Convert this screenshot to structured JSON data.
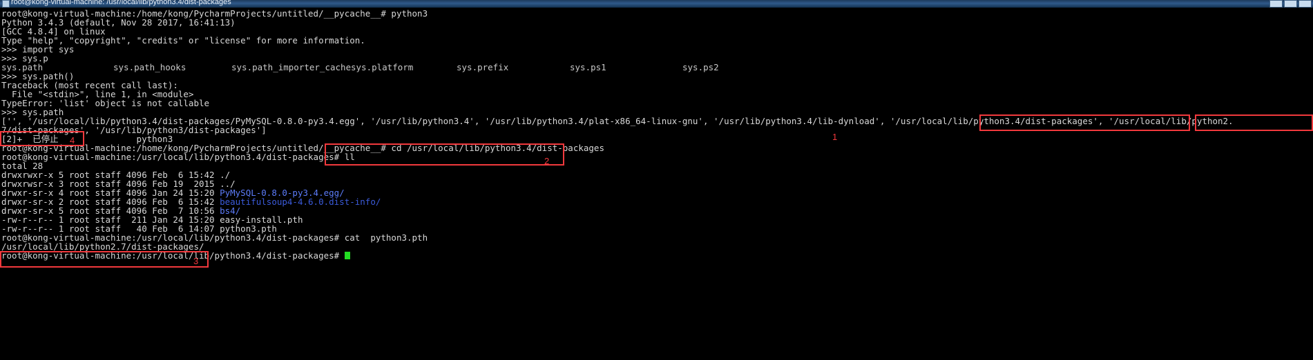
{
  "window": {
    "title": "root@kong-virtual-machine: /usr/local/lib/python3.4/dist-packages",
    "icon": "terminal-icon",
    "buttons": [
      "minimize",
      "maximize",
      "close"
    ]
  },
  "terminal": {
    "lines": [
      "root@kong-virtual-machine:/home/kong/PycharmProjects/untitled/__pycache__# python3",
      "Python 3.4.3 (default, Nov 28 2017, 16:41:13)",
      "[GCC 4.8.4] on linux",
      "Type \"help\", \"copyright\", \"credits\" or \"license\" for more information.",
      ">>> import sys",
      ">>> sys.p",
      ">>> sys.path()",
      "Traceback (most recent call last):",
      "  File \"<stdin>\", line 1, in <module>",
      "TypeError: 'list' object is not callable",
      ">>> sys.path",
      "['', '/usr/local/lib/python3.4/dist-packages/PyMySQL-0.8.0-py3.4.egg', '/usr/lib/python3.4', '/usr/lib/python3.4/plat-x86_64-linux-gnu', '/usr/lib/python3.4/lib-dynload', '/usr/local/lib/python3.4/dist-packages', '/usr/local/lib/python2.",
      "7/dist-packages', '/usr/lib/python3/dist-packages']",
      "[2]+  已停止               python3",
      "root@kong-virtual-machine:/home/kong/PycharmProjects/untitled/__pycache__# cd /usr/local/lib/python3.4/dist-packages",
      "root@kong-virtual-machine:/usr/local/lib/python3.4/dist-packages# ll",
      "total 28",
      "drwxrwxr-x 5 root staff 4096 Feb  6 15:42 ./",
      "drwxrwsr-x 3 root staff 4096 Feb 19  2015 ../",
      "drwxr-sr-x 4 root staff 4096 Jan 24 15:20 PyMySQL-0.8.0-py3.4.egg/",
      "drwxr-sr-x 2 root staff 4096 Feb  6 15:42 beautifulsoup4-4.6.0.dist-info/",
      "drwxr-sr-x 5 root staff 4096 Feb  7 10:56 bs4/",
      "-rw-r--r-- 1 root staff  211 Jan 24 15:20 easy-install.pth",
      "-rw-r--r-- 1 root staff   40 Feb  6 14:07 python3.pth",
      "root@kong-virtual-machine:/usr/local/lib/python3.4/dist-packages# cat  python3.pth",
      "/usr/local/lib/python2.7/dist-packages/",
      "root@kong-virtual-machine:/usr/local/lib/python3.4/dist-packages# "
    ],
    "completions": [
      "sys.path",
      "sys.path_hooks",
      "sys.path_importer_cache",
      "sys.platform",
      "sys.prefix",
      "sys.ps1",
      "sys.ps2"
    ],
    "listing_dir_color": "#5c7cfa",
    "prompt_user": "root@kong-virtual-machine",
    "cursor": "block-cursor"
  },
  "annotations": [
    {
      "number": "1",
      "target": "'/usr/local/lib/python3.4/dist-packages'"
    },
    {
      "number": "2",
      "target": "cd /usr/local/lib/python3.4/dist-packages"
    },
    {
      "number": "3",
      "target": "/usr/local/lib/python2.7/dist-packages/"
    },
    {
      "number": "4",
      "target": "7/dist-packages'"
    },
    {
      "number": "",
      "target": "'/usr/local/lib/python2."
    }
  ],
  "annotation_color": "#f2393d"
}
